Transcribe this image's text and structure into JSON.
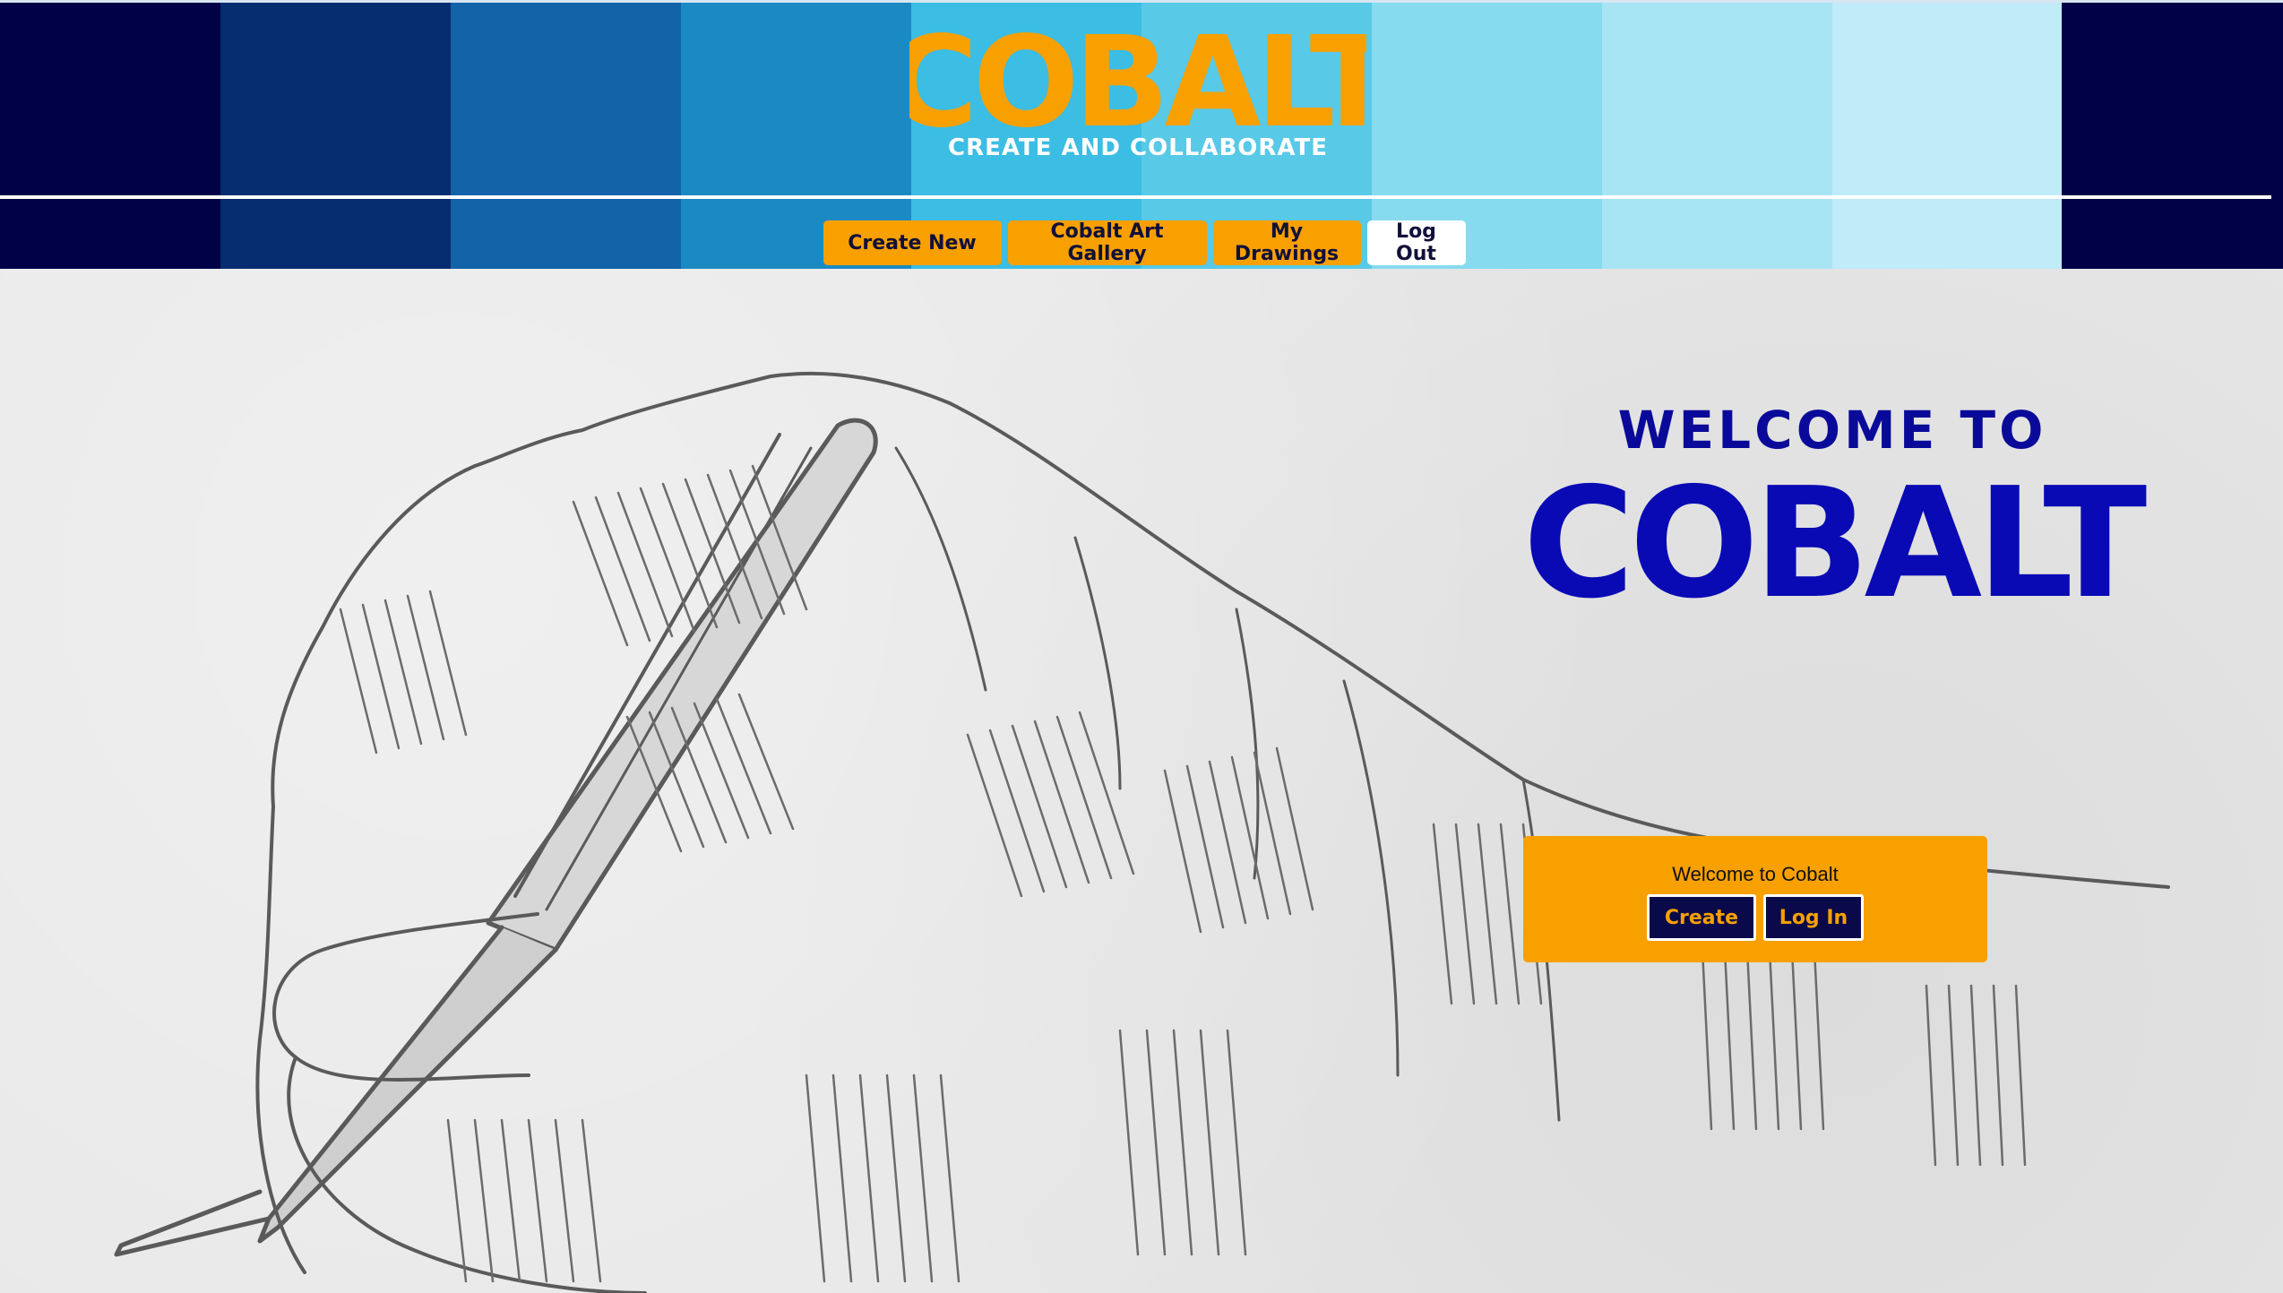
{
  "header": {
    "brand_name": "COBALT",
    "tagline": "CREATE AND COLLABORATE",
    "stripe_colors": [
      "#010147",
      "#062d70",
      "#1263a8",
      "#1b8ac3",
      "#3cbde3",
      "#82dbef",
      "#a6e4f4",
      "#bfebf8",
      "#010147"
    ]
  },
  "nav": {
    "items": [
      {
        "label": "Create New"
      },
      {
        "label": "Cobalt Art Gallery"
      },
      {
        "label": "My Drawings"
      },
      {
        "label": "Log Out"
      }
    ]
  },
  "hero": {
    "welcome_line1": "WELCOME TO",
    "welcome_line2": "COBALT",
    "card": {
      "text": "Welcome to Cobalt",
      "create_label": "Create",
      "login_label": "Log In"
    }
  },
  "colors": {
    "accent_orange": "#f7a000",
    "brand_blue": "#0a0ab4",
    "navy": "#010147"
  }
}
